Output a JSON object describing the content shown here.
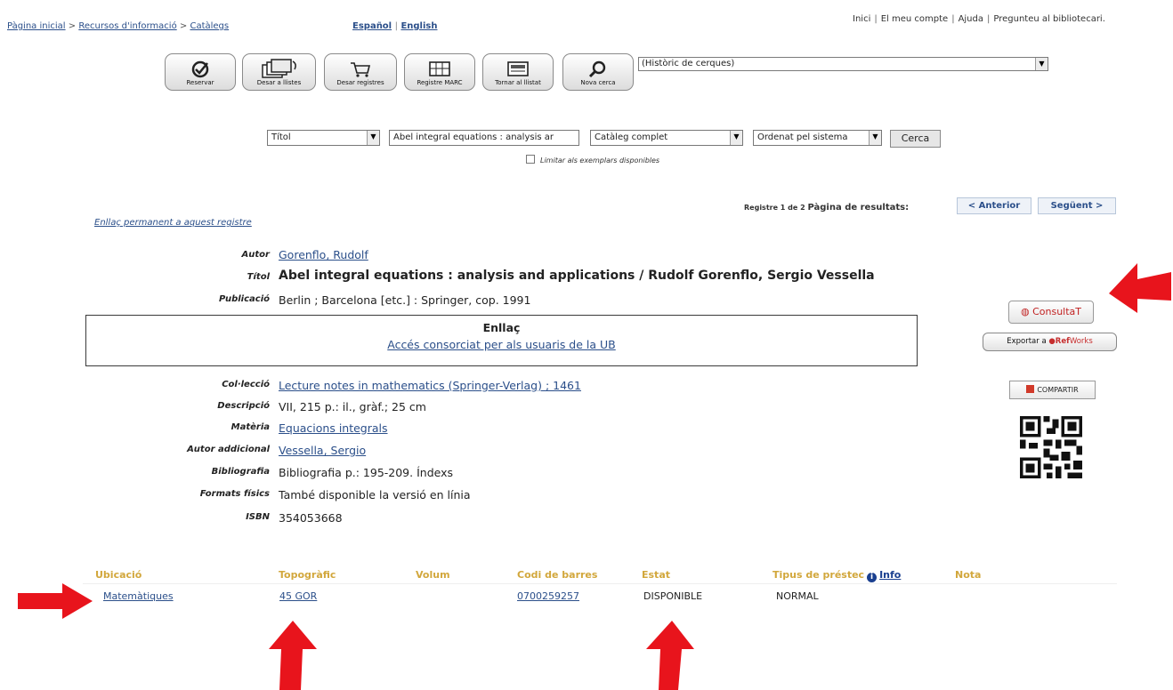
{
  "breadcrumb": {
    "home": "Pàgina inicial",
    "sep": ">",
    "resources": "Recursos d'informació",
    "catalogs": "Catàlegs"
  },
  "languages": {
    "spanish": "Español",
    "sep": "|",
    "english": "English"
  },
  "top_nav": {
    "items": [
      "Inici",
      "El meu compte",
      "Ajuda",
      "Pregunteu al bibliotecari"
    ],
    "sep": "|",
    "trailing": "."
  },
  "toolbar": {
    "reserve": "Reservar",
    "save_list": "Desar a llistes",
    "save_records": "Desar registres",
    "marc": "Registre MARC",
    "back_list": "Tornar al llistat",
    "new_search": "Nova cerca",
    "history": "(Històric de cerques)"
  },
  "search": {
    "field": "Títol",
    "query": "Abel integral equations : analysis ar",
    "catalog": "Catàleg complet",
    "sort": "Ordenat pel sistema",
    "button": "Cerca",
    "limit_label": "Limitar als exemplars disponibles"
  },
  "record_nav": {
    "count": "Registre 1 de 2",
    "pages_label": "Pàgina de resultats:",
    "prev": "< Anterior",
    "next": "Següent >"
  },
  "permalink": "Enllaç permanent a aquest registre",
  "record": {
    "author_label": "Autor",
    "author": "Gorenflo, Rudolf",
    "title_label": "Títol",
    "title": "Abel integral equations : analysis and applications / Rudolf Gorenflo, Sergio Vessella",
    "publication_label": "Publicació",
    "publication": "Berlin ; Barcelona [etc.] : Springer, cop. 1991",
    "link_header": "Enllaç",
    "link_text": "Accés consorciat per als usuaris de la UB",
    "series_label": "Col·lecció",
    "series": "Lecture notes in mathematics (Springer-Verlag) ; 1461",
    "description_label": "Descripció",
    "description": "VII, 215 p.: il., gràf.; 25 cm",
    "subject_label": "Matèria",
    "subject": "Equacions integrals",
    "added_author_label": "Autor addicional",
    "added_author": "Vessella, Sergio",
    "bibliography_label": "Bibliografia",
    "bibliography": "Bibliografia p.: 195-209. Índexs",
    "formats_label": "Formats físics",
    "formats": "També disponible la versió en línia",
    "isbn_label": "ISBN",
    "isbn": "354053668"
  },
  "side": {
    "consulta": "ConsultaT",
    "export_prefix": "Exportar a",
    "export_ref": "Ref",
    "export_works": "Works",
    "share": "COMPARTIR"
  },
  "holdings": {
    "headers": {
      "location": "Ubicació",
      "callnumber": "Topogràfic",
      "volume": "Volum",
      "barcode": "Codi de barres",
      "status": "Estat",
      "loan_type": "Tipus de préstec",
      "info": "Info",
      "note": "Nota"
    },
    "row": {
      "location": "Matemàtiques",
      "callnumber": "45 GOR",
      "volume": "",
      "barcode": "0700259257",
      "status": "DISPONIBLE",
      "loan_type": "NORMAL",
      "note": ""
    }
  },
  "colors": {
    "link": "#2b4f8a",
    "holdings_header": "#d2a73c",
    "arrow": "#e8141c",
    "refworks": "#c62e2e"
  }
}
